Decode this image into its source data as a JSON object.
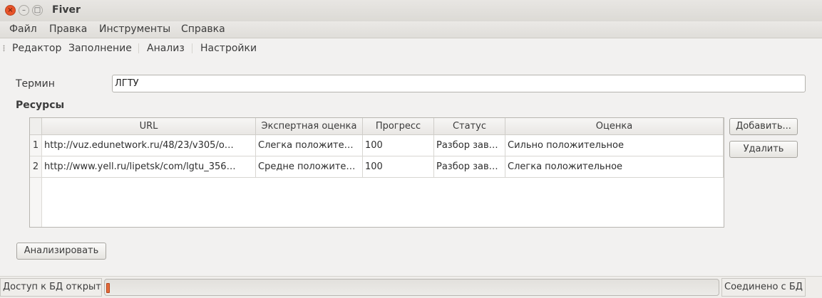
{
  "window": {
    "title": "Fiver"
  },
  "menu": [
    "Файл",
    "Правка",
    "Инструменты",
    "Справка"
  ],
  "toolbar": [
    "Редактор",
    "Заполнение",
    "Анализ",
    "Настройки"
  ],
  "term": {
    "label": "Термин",
    "value": "ЛГТУ"
  },
  "resources": {
    "label": "Ресурсы",
    "columns": [
      "URL",
      "Экспертная оценка",
      "Прогресс",
      "Статус",
      "Оценка"
    ],
    "rows": [
      {
        "num": "1",
        "url": "http://vuz.edunetwork.ru/48/23/v305/o…",
        "expert": "Слегка положите…",
        "progress": "100",
        "status": "Разбор зав…",
        "rating": "Сильно положительное"
      },
      {
        "num": "2",
        "url": "http://www.yell.ru/lipetsk/com/lgtu_356…",
        "expert": "Средне положите…",
        "progress": "100",
        "status": "Разбор зав…",
        "rating": "Слегка положительное"
      }
    ]
  },
  "buttons": {
    "add": "Добавить...",
    "remove": "Удалить",
    "analyze": "Анализировать"
  },
  "status": {
    "left": "Доступ к БД открыт",
    "right": "Соединено с БД",
    "progress_fraction": 0.003
  },
  "colors": {
    "close_button": "#e9542a",
    "progress_fill": "#e46a3a"
  }
}
